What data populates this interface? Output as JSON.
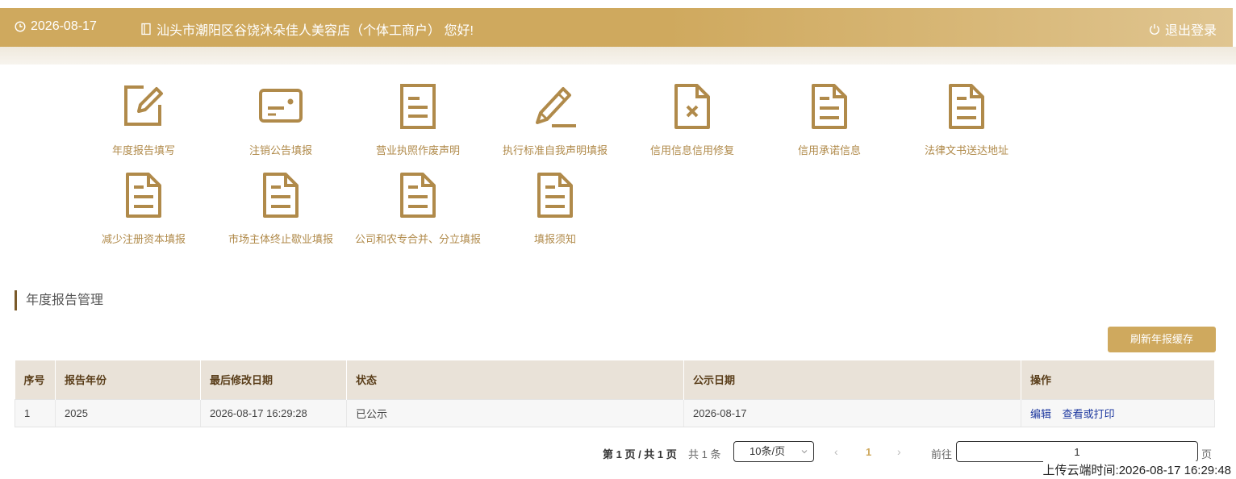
{
  "header": {
    "date": "2026-08-17",
    "welcome": "汕头市潮阳区谷饶沐朵佳人美容店（个体工商户） 您好!",
    "logout": "退出登录",
    "colors": {
      "brand": "#cfa95e",
      "icon": "#b08a4a"
    }
  },
  "menu": {
    "items": [
      {
        "label": "年度报告填写",
        "icon": "edit-icon"
      },
      {
        "label": "注销公告填报",
        "icon": "card-icon"
      },
      {
        "label": "营业执照作废声明",
        "icon": "document-icon"
      },
      {
        "label": "执行标准自我声明填报",
        "icon": "pencil-icon"
      },
      {
        "label": "信用信息信用修复",
        "icon": "document-x-icon"
      },
      {
        "label": "信用承诺信息",
        "icon": "document-icon"
      },
      {
        "label": "法律文书送达地址",
        "icon": "document-icon"
      },
      {
        "label": "减少注册资本填报",
        "icon": "document-icon"
      },
      {
        "label": "市场主体终止歇业填报",
        "icon": "document-icon"
      },
      {
        "label": "公司和农专合并、分立填报",
        "icon": "document-icon"
      },
      {
        "label": "填报须知",
        "icon": "document-icon"
      }
    ]
  },
  "section": {
    "title": "年度报告管理"
  },
  "toolbar": {
    "refresh_label": "刷新年报缓存"
  },
  "table": {
    "columns": [
      "序号",
      "报告年份",
      "最后修改日期",
      "状态",
      "公示日期",
      "操作"
    ],
    "rows": [
      {
        "index": "1",
        "year": "2025",
        "modified": "2026-08-17 16:29:28",
        "status": "已公示",
        "publish_date": "2026-08-17",
        "actions": [
          "编辑",
          "查看或打印"
        ]
      }
    ]
  },
  "pagination": {
    "page_info": "第 1 页 / 共 1 页",
    "total": "共 1 条",
    "page_size": "10条/页",
    "current_page": "1",
    "goto_label": "前往",
    "goto_value": "1",
    "page_suffix": "页"
  },
  "footer": {
    "upload_time": "上传云端时间:2026-08-17 16:29:48"
  }
}
